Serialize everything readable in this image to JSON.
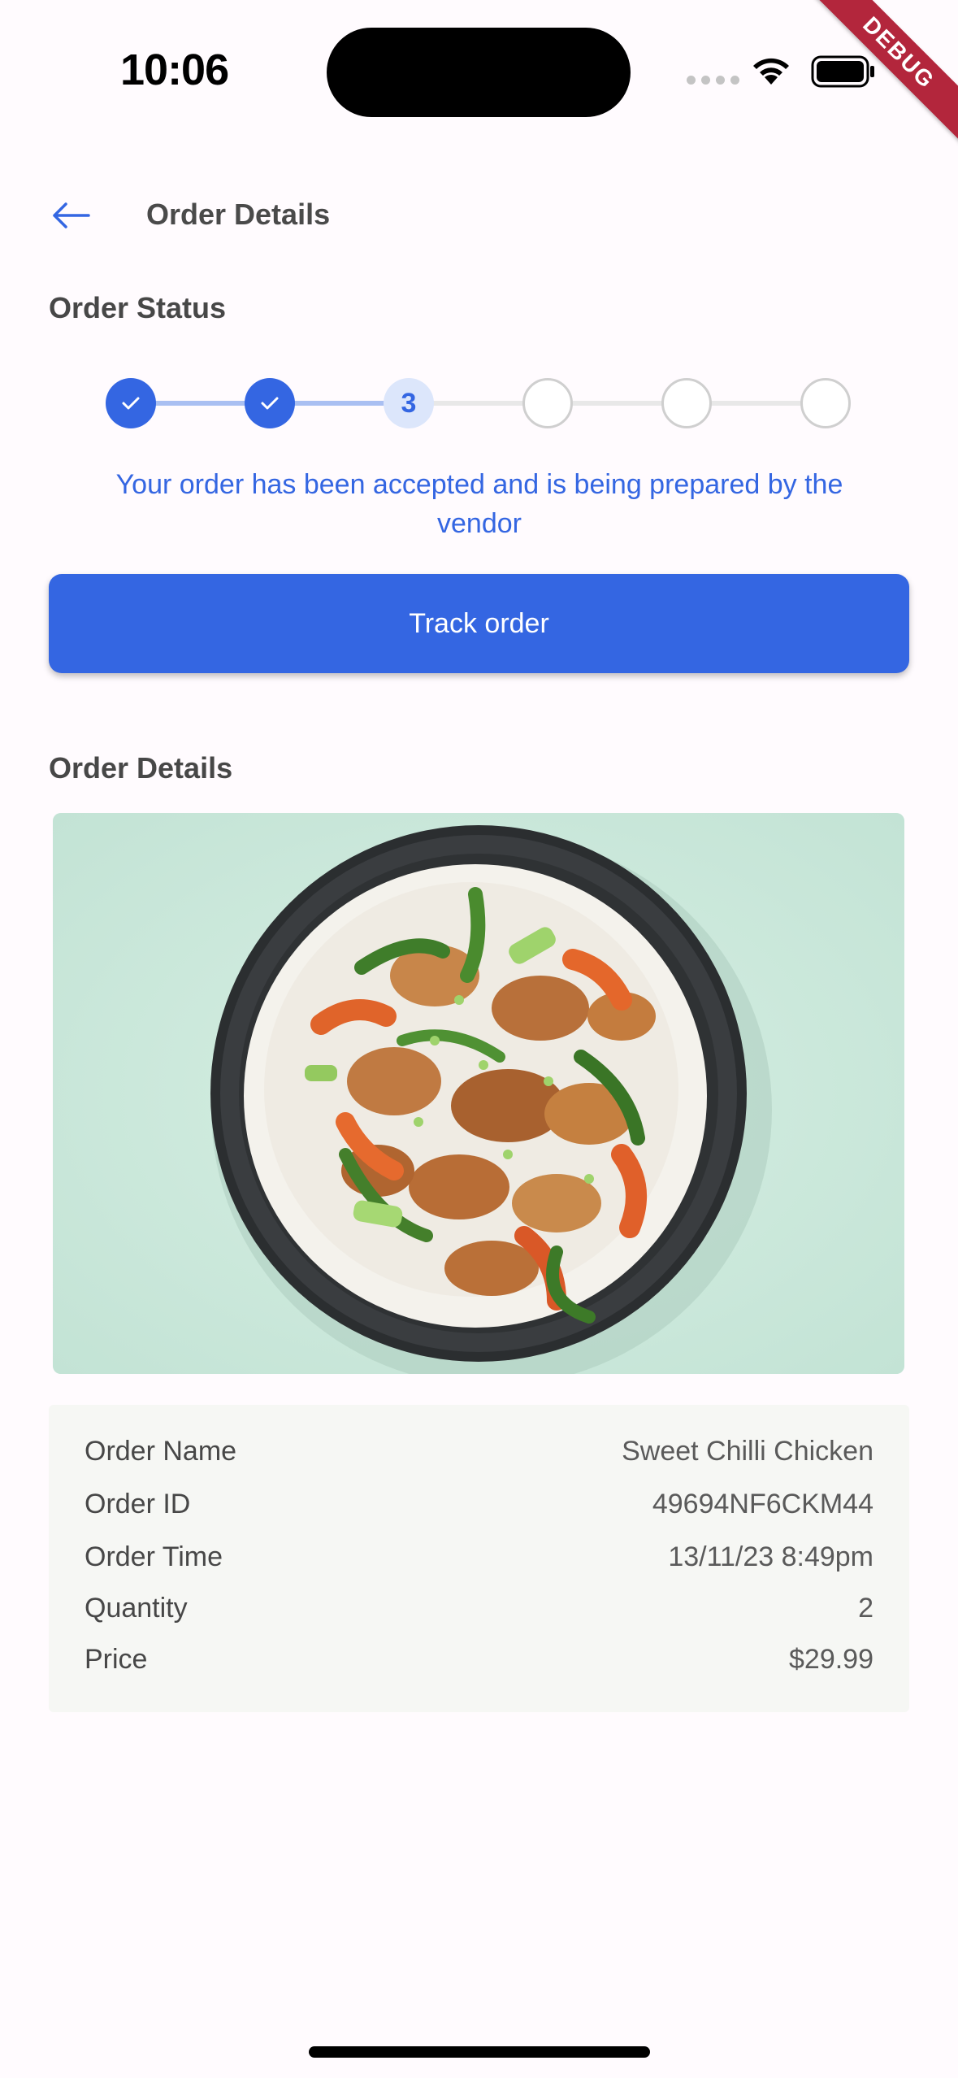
{
  "status_bar": {
    "time": "10:06",
    "debug_label": "DEBUG"
  },
  "appbar": {
    "title": "Order Details"
  },
  "order_status": {
    "section_title": "Order Status",
    "steps": [
      {
        "state": "done",
        "label": ""
      },
      {
        "state": "done",
        "label": ""
      },
      {
        "state": "current",
        "label": "3"
      },
      {
        "state": "todo",
        "label": ""
      },
      {
        "state": "todo",
        "label": ""
      },
      {
        "state": "todo",
        "label": ""
      }
    ],
    "message": "Your order has been accepted and is being prepared by the vendor",
    "track_button": "Track order"
  },
  "order_details": {
    "section_title": "Order Details",
    "rows": [
      {
        "label": "Order Name",
        "value": "Sweet Chilli Chicken"
      },
      {
        "label": "Order ID",
        "value": "49694NF6CKM44"
      },
      {
        "label": "Order Time",
        "value": "13/11/23 8:49pm"
      },
      {
        "label": "Quantity",
        "value": "2"
      },
      {
        "label": "Price",
        "value": "$29.99"
      }
    ]
  },
  "colors": {
    "primary": "#3466E2",
    "background": "#FFFBFE",
    "card": "#F6F7F4"
  }
}
